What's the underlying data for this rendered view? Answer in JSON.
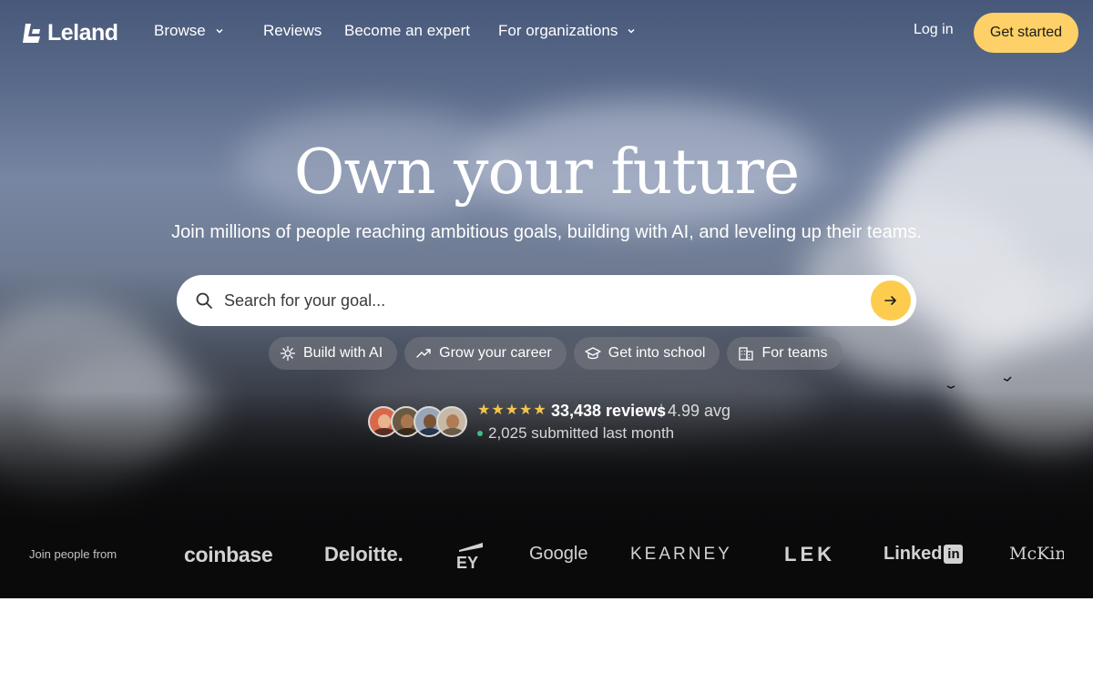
{
  "brand": {
    "name": "Leland"
  },
  "nav": {
    "items": [
      {
        "label": "Browse",
        "has_dropdown": true
      },
      {
        "label": "Reviews",
        "has_dropdown": false
      },
      {
        "label": "Become an expert",
        "has_dropdown": false
      },
      {
        "label": "For organizations",
        "has_dropdown": true
      }
    ],
    "login_label": "Log in",
    "cta_label": "Get started"
  },
  "hero": {
    "title": "Own your future",
    "subtitle": "Join millions of people reaching ambitious goals, building with AI, and leveling up their teams."
  },
  "search": {
    "placeholder": "Search for your goal..."
  },
  "chips": [
    {
      "label": "Build with AI",
      "icon": "ai-spark-icon"
    },
    {
      "label": "Grow your career",
      "icon": "trend-up-icon"
    },
    {
      "label": "Get into school",
      "icon": "graduation-cap-icon"
    },
    {
      "label": "For teams",
      "icon": "building-icon"
    }
  ],
  "reviews": {
    "rating_stars": 5,
    "count_text": "33,438 reviews",
    "separator": "|",
    "avg_text": "4.99 avg",
    "submitted_text": "2,025 submitted last month"
  },
  "logos": {
    "label": "Join people from",
    "items": [
      "coinbase",
      "Deloitte.",
      "EY",
      "Google",
      "KEARNEY",
      "LEK",
      "LinkedIn",
      "McKinsey"
    ]
  },
  "colors": {
    "cta": "#fdd167",
    "search_button": "#fdcc4e",
    "stars": "#f7c34a",
    "online_dot": "#3fbf86"
  }
}
